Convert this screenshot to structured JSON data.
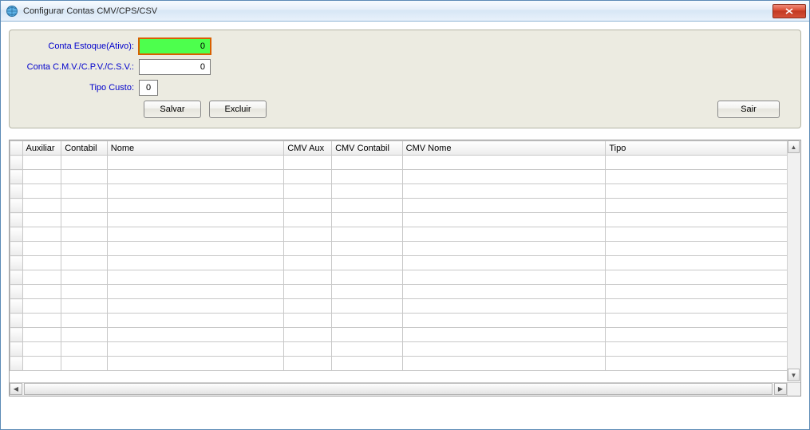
{
  "window": {
    "title": "Configurar Contas CMV/CPS/CSV"
  },
  "form": {
    "conta_estoque_label": "Conta Estoque(Ativo):",
    "conta_estoque_value": "0",
    "conta_cmv_label": "Conta C.M.V./C.P.V./C.S.V.:",
    "conta_cmv_value": "0",
    "tipo_custo_label": "Tipo Custo:",
    "tipo_custo_value": "0"
  },
  "buttons": {
    "salvar": "Salvar",
    "excluir": "Excluir",
    "sair": "Sair"
  },
  "grid": {
    "headers": {
      "auxiliar": "Auxiliar",
      "contabil": "Contabil",
      "nome": "Nome",
      "cmv_aux": "CMV Aux",
      "cmv_contabil": "CMV Contabil",
      "cmv_nome": "CMV Nome",
      "tipo": "Tipo"
    },
    "rows": [
      {
        "auxiliar": "",
        "contabil": "",
        "nome": "",
        "cmv_aux": "",
        "cmv_contabil": "",
        "cmv_nome": "",
        "tipo": ""
      },
      {
        "auxiliar": "",
        "contabil": "",
        "nome": "",
        "cmv_aux": "",
        "cmv_contabil": "",
        "cmv_nome": "",
        "tipo": ""
      },
      {
        "auxiliar": "",
        "contabil": "",
        "nome": "",
        "cmv_aux": "",
        "cmv_contabil": "",
        "cmv_nome": "",
        "tipo": ""
      },
      {
        "auxiliar": "",
        "contabil": "",
        "nome": "",
        "cmv_aux": "",
        "cmv_contabil": "",
        "cmv_nome": "",
        "tipo": ""
      },
      {
        "auxiliar": "",
        "contabil": "",
        "nome": "",
        "cmv_aux": "",
        "cmv_contabil": "",
        "cmv_nome": "",
        "tipo": ""
      },
      {
        "auxiliar": "",
        "contabil": "",
        "nome": "",
        "cmv_aux": "",
        "cmv_contabil": "",
        "cmv_nome": "",
        "tipo": ""
      },
      {
        "auxiliar": "",
        "contabil": "",
        "nome": "",
        "cmv_aux": "",
        "cmv_contabil": "",
        "cmv_nome": "",
        "tipo": ""
      },
      {
        "auxiliar": "",
        "contabil": "",
        "nome": "",
        "cmv_aux": "",
        "cmv_contabil": "",
        "cmv_nome": "",
        "tipo": ""
      },
      {
        "auxiliar": "",
        "contabil": "",
        "nome": "",
        "cmv_aux": "",
        "cmv_contabil": "",
        "cmv_nome": "",
        "tipo": ""
      },
      {
        "auxiliar": "",
        "contabil": "",
        "nome": "",
        "cmv_aux": "",
        "cmv_contabil": "",
        "cmv_nome": "",
        "tipo": ""
      },
      {
        "auxiliar": "",
        "contabil": "",
        "nome": "",
        "cmv_aux": "",
        "cmv_contabil": "",
        "cmv_nome": "",
        "tipo": ""
      },
      {
        "auxiliar": "",
        "contabil": "",
        "nome": "",
        "cmv_aux": "",
        "cmv_contabil": "",
        "cmv_nome": "",
        "tipo": ""
      },
      {
        "auxiliar": "",
        "contabil": "",
        "nome": "",
        "cmv_aux": "",
        "cmv_contabil": "",
        "cmv_nome": "",
        "tipo": ""
      },
      {
        "auxiliar": "",
        "contabil": "",
        "nome": "",
        "cmv_aux": "",
        "cmv_contabil": "",
        "cmv_nome": "",
        "tipo": ""
      },
      {
        "auxiliar": "",
        "contabil": "",
        "nome": "",
        "cmv_aux": "",
        "cmv_contabil": "",
        "cmv_nome": "",
        "tipo": ""
      }
    ]
  }
}
